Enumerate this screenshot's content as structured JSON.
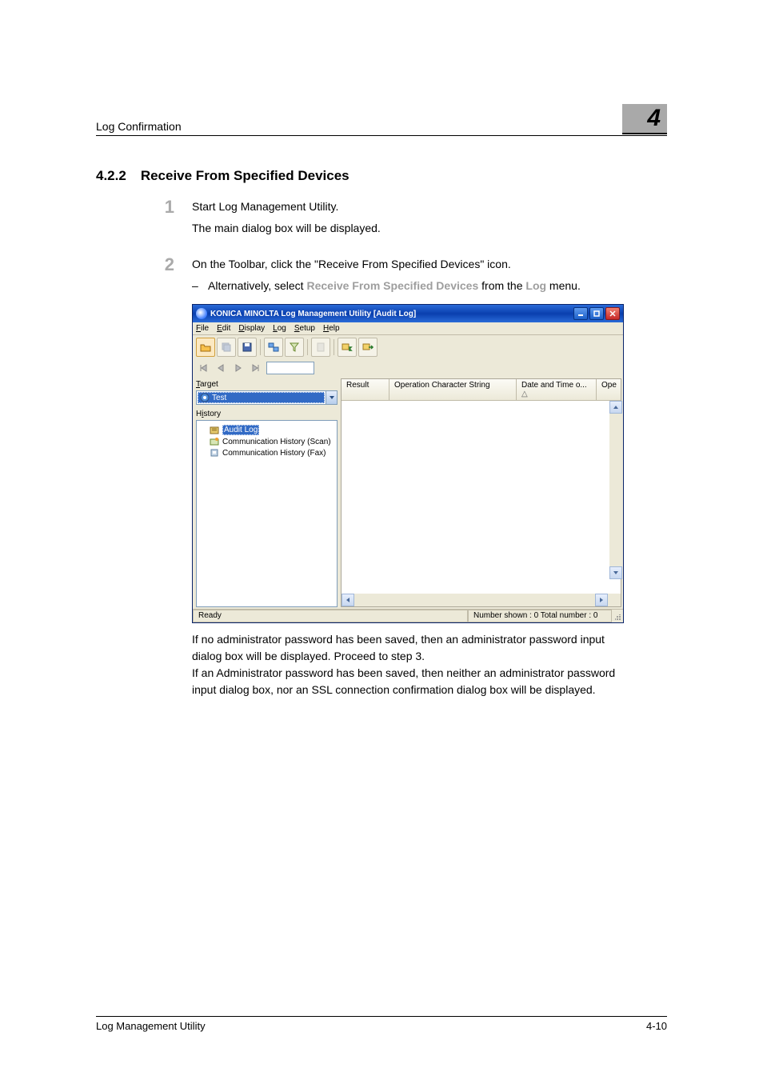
{
  "header": {
    "running": "Log Confirmation",
    "chapter": "4"
  },
  "section": {
    "number": "4.2.2",
    "title": "Receive From Specified Devices"
  },
  "steps": {
    "s1": {
      "num": "1",
      "p1": "Start Log Management Utility.",
      "p2": "The main dialog box will be displayed."
    },
    "s2": {
      "num": "2",
      "p1": "On the Toolbar, click the \"Receive From Specified Devices\" icon.",
      "bullet_pre": "Alternatively, select ",
      "bullet_bold": "Receive From Specified Devices",
      "bullet_mid": " from the ",
      "bullet_bold2": "Log",
      "bullet_post": " menu."
    }
  },
  "screenshot": {
    "title": "KONICA MINOLTA Log Management Utility [Audit Log]",
    "menus": {
      "file": "File",
      "edit": "Edit",
      "display": "Display",
      "log": "Log",
      "setup": "Setup",
      "help": "Help"
    },
    "left": {
      "target_label": "Target",
      "target_value": "Test",
      "history_label": "History",
      "tree": {
        "audit": "Audit Log",
        "scan": "Communication History (Scan)",
        "fax": "Communication History (Fax)"
      }
    },
    "grid": {
      "c1": "Result",
      "c2": "Operation Character String",
      "c3": "Date and Time o...",
      "c4": "Ope"
    },
    "status": {
      "ready": "Ready",
      "counts": "Number shown : 0  Total number : 0"
    }
  },
  "after_para": "If no administrator password has been saved, then an administrator password input dialog box will be displayed. Proceed to step 3.\nIf an Administrator password has been saved, then neither an administrator password input dialog box, nor an SSL connection confirmation dialog box will be displayed.",
  "footer": {
    "left": "Log Management Utility",
    "right": "4-10"
  }
}
